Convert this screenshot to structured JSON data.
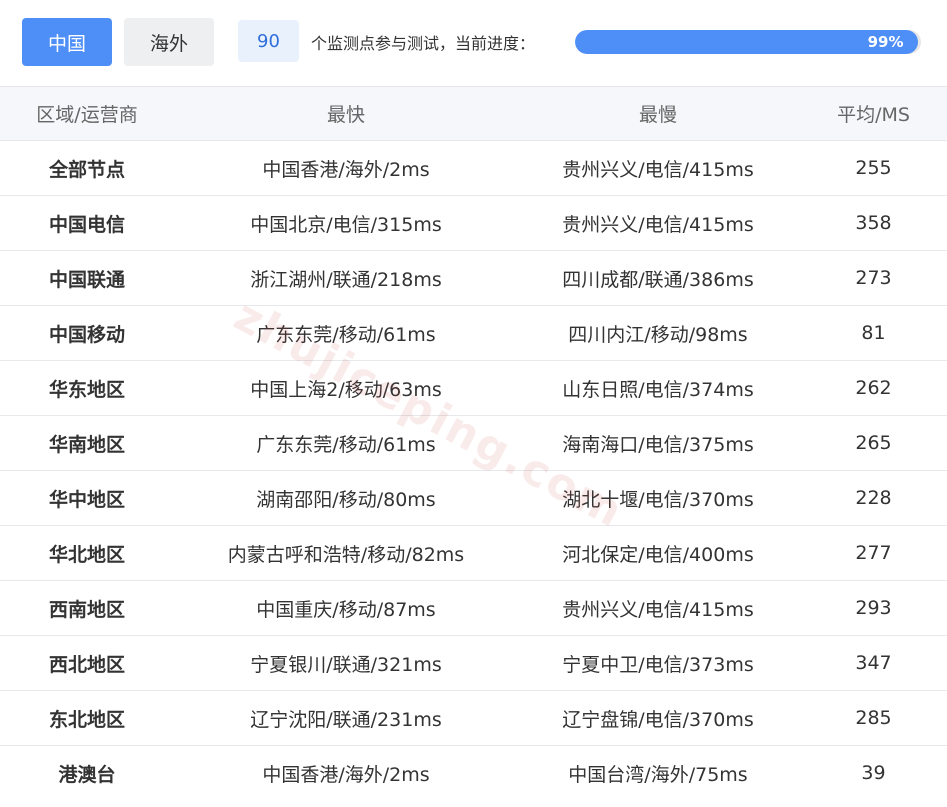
{
  "tabs": {
    "china": "中国",
    "overseas": "海外"
  },
  "progress": {
    "count": "90",
    "text": "个监测点参与测试，当前进度：",
    "percent_label": "99%",
    "percent": 0.99
  },
  "colors": {
    "accent": "#4d8ef7",
    "count_bg": "#e9f1fd",
    "header_bg": "#f5f7fa"
  },
  "table": {
    "headers": [
      "区域/运营商",
      "最快",
      "最慢",
      "平均/MS"
    ],
    "rows": [
      [
        "全部节点",
        "中国香港/海外/2ms",
        "贵州兴义/电信/415ms",
        "255"
      ],
      [
        "中国电信",
        "中国北京/电信/315ms",
        "贵州兴义/电信/415ms",
        "358"
      ],
      [
        "中国联通",
        "浙江湖州/联通/218ms",
        "四川成都/联通/386ms",
        "273"
      ],
      [
        "中国移动",
        "广东东莞/移动/61ms",
        "四川内江/移动/98ms",
        "81"
      ],
      [
        "华东地区",
        "中国上海2/移动/63ms",
        "山东日照/电信/374ms",
        "262"
      ],
      [
        "华南地区",
        "广东东莞/移动/61ms",
        "海南海口/电信/375ms",
        "265"
      ],
      [
        "华中地区",
        "湖南邵阳/移动/80ms",
        "湖北十堰/电信/370ms",
        "228"
      ],
      [
        "华北地区",
        "内蒙古呼和浩特/移动/82ms",
        "河北保定/电信/400ms",
        "277"
      ],
      [
        "西南地区",
        "中国重庆/移动/87ms",
        "贵州兴义/电信/415ms",
        "293"
      ],
      [
        "西北地区",
        "宁夏银川/联通/321ms",
        "宁夏中卫/电信/373ms",
        "347"
      ],
      [
        "东北地区",
        "辽宁沈阳/联通/231ms",
        "辽宁盘锦/电信/370ms",
        "285"
      ],
      [
        "港澳台",
        "中国香港/海外/2ms",
        "中国台湾/海外/75ms",
        "39"
      ]
    ]
  },
  "watermark": "zhujiceping.com"
}
